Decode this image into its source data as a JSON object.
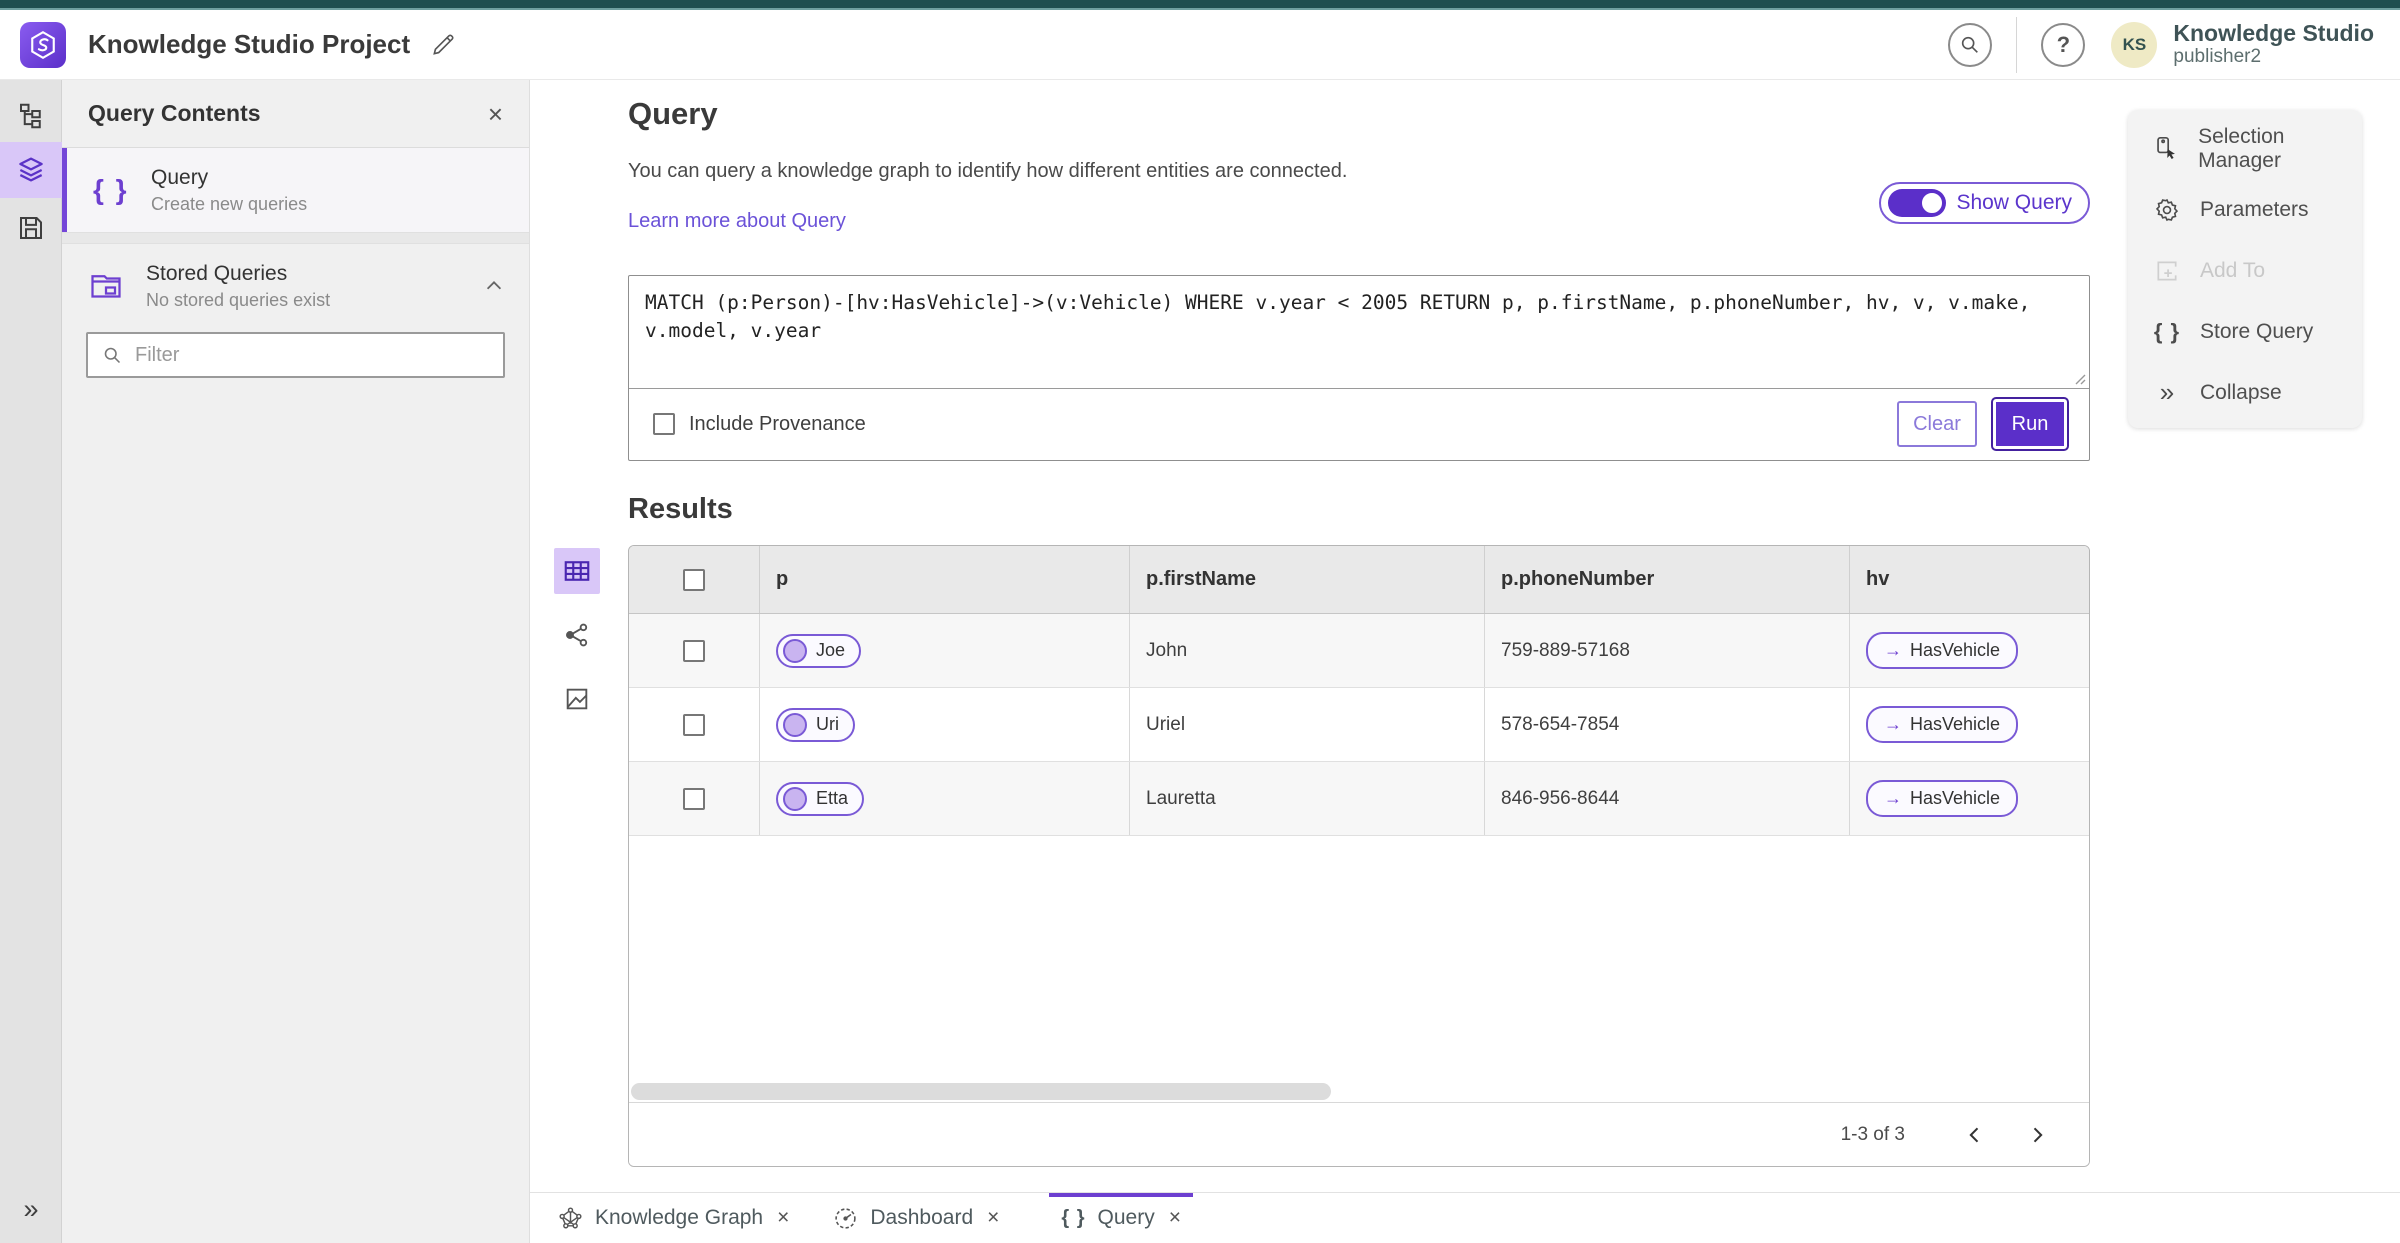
{
  "header": {
    "app_title": "Knowledge Studio Project",
    "product_name": "Knowledge Studio",
    "user_name": "publisher2",
    "avatar_initials": "KS"
  },
  "sidebar": {
    "title": "Query Contents",
    "query_item": {
      "title": "Query",
      "subtitle": "Create new queries"
    },
    "stored_queries": {
      "title": "Stored Queries",
      "subtitle": "No stored queries exist"
    },
    "filter_placeholder": "Filter"
  },
  "main": {
    "title": "Query",
    "description": "You can query a knowledge graph to identify how different entities are connected.",
    "learn_more": "Learn more about Query",
    "show_query_label": "Show Query",
    "query_text": "MATCH (p:Person)-[hv:HasVehicle]->(v:Vehicle) WHERE v.year < 2005 RETURN p, p.firstName, p.phoneNumber, hv, v, v.make, v.model, v.year",
    "include_provenance_label": "Include Provenance",
    "clear_label": "Clear",
    "run_label": "Run",
    "results_title": "Results"
  },
  "results_table": {
    "columns": [
      "p",
      "p.firstName",
      "p.phoneNumber",
      "hv"
    ],
    "rows": [
      {
        "p": "Joe",
        "firstName": "John",
        "phoneNumber": "759-889-57168",
        "hv": "HasVehicle"
      },
      {
        "p": "Uri",
        "firstName": "Uriel",
        "phoneNumber": "578-654-7854",
        "hv": "HasVehicle"
      },
      {
        "p": "Etta",
        "firstName": "Lauretta",
        "phoneNumber": "846-956-8644",
        "hv": "HasVehicle"
      }
    ],
    "pagination": "1-3 of 3"
  },
  "right_panel": {
    "items": [
      {
        "label": "Selection Manager",
        "disabled": false
      },
      {
        "label": "Parameters",
        "disabled": false
      },
      {
        "label": "Add To",
        "disabled": true
      },
      {
        "label": "Store Query",
        "disabled": false
      },
      {
        "label": "Collapse",
        "disabled": false
      }
    ]
  },
  "bottom_tabs": [
    {
      "label": "Knowledge Graph",
      "active": false
    },
    {
      "label": "Dashboard",
      "active": false
    },
    {
      "label": "Query",
      "active": true
    }
  ],
  "icons": {
    "close": "×",
    "braces": "{ }",
    "arrow_right": "→",
    "chevron_double_right": "»",
    "question_mark": "?"
  },
  "colors": {
    "accent_purple": "#5b2fc9",
    "accent_purple_light": "#d9c7f8",
    "pill_border": "#7a5ad6",
    "top_bar_teal": "#1f4f50",
    "avatar_bg": "#efeac5",
    "link": "#6b52d8",
    "panel_bg": "#f0f0f0"
  }
}
